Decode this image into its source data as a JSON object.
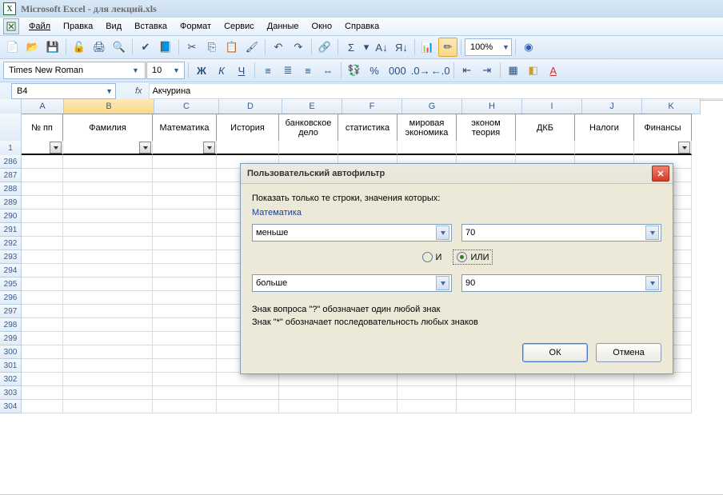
{
  "title": "Microsoft Excel - для лекций.xls",
  "menu": [
    "Файл",
    "Правка",
    "Вид",
    "Вставка",
    "Формат",
    "Сервис",
    "Данные",
    "Окно",
    "Справка"
  ],
  "zoom": "100%",
  "font_name": "Times New Roman",
  "font_size": "10",
  "name_box": "B4",
  "fx_label": "fx",
  "formula": "Акчурина",
  "columns": [
    "A",
    "B",
    "C",
    "D",
    "E",
    "F",
    "G",
    "H",
    "I",
    "J",
    "K"
  ],
  "headers": [
    "№ пп",
    "Фамилия",
    "Математика",
    "История",
    "банковское дело",
    "статистика",
    "мировая экономика",
    "эконом теория",
    "ДКБ",
    "Налоги",
    "Финансы"
  ],
  "selected_col_index": 1,
  "row_numbers_first": "1",
  "row_numbers": [
    286,
    287,
    288,
    289,
    290,
    291,
    292,
    293,
    294,
    295,
    296,
    297,
    298,
    299,
    300,
    301,
    302,
    303,
    304
  ],
  "dialog": {
    "title": "Пользовательский автофильтр",
    "label": "Показать только те строки, значения которых:",
    "field": "Математика",
    "op1": "меньше",
    "val1": "70",
    "radio_and": "И",
    "radio_or": "ИЛИ",
    "radio_selected": "or",
    "op2": "больше",
    "val2": "90",
    "help1": "Знак вопроса \"?\" обозначает один любой знак",
    "help2": "Знак \"*\" обозначает последовательность любых знаков",
    "ok": "ОК",
    "cancel": "Отмена"
  },
  "glyphs": {
    "bold": "Ж",
    "italic": "К",
    "under": "Ч"
  }
}
